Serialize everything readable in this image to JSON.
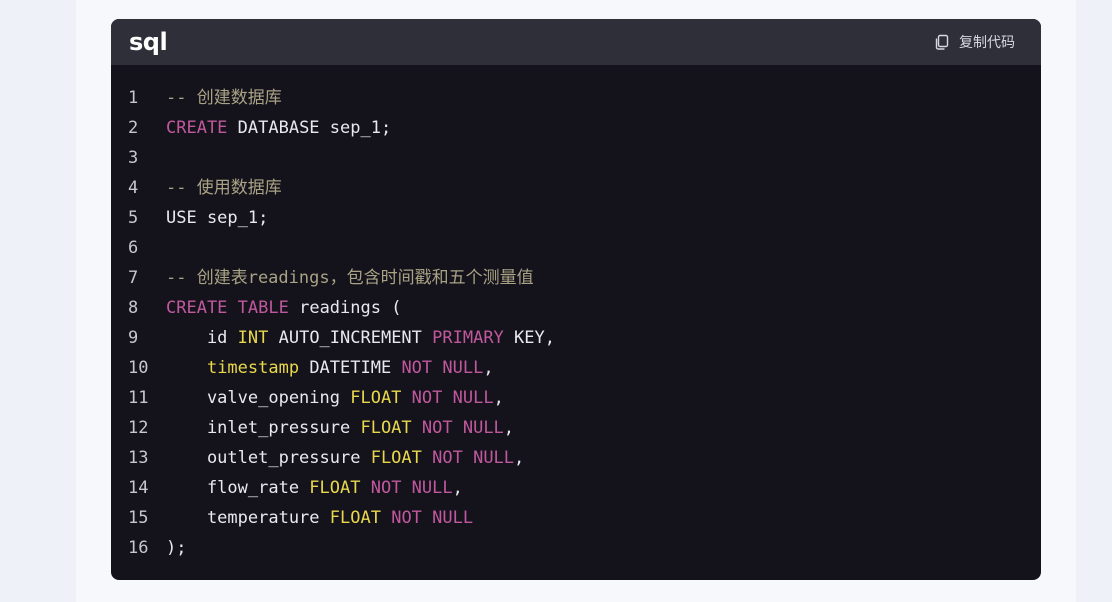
{
  "code_block": {
    "language": "sql",
    "copy_label": "复制代码",
    "icon": "copy-icon",
    "colors": {
      "background": "#14131c",
      "header": "#2f2f39",
      "comment": "#a9a284",
      "keyword": "#c0589d",
      "type": "#e9d84c",
      "plain": "#e8e8ee"
    },
    "lines": [
      {
        "n": "1",
        "tokens": [
          {
            "t": "-- 创建数据库",
            "k": "comment"
          }
        ]
      },
      {
        "n": "2",
        "tokens": [
          {
            "t": "CREATE",
            "k": "keyword"
          },
          {
            "t": " DATABASE sep_1;",
            "k": "plain"
          }
        ]
      },
      {
        "n": "3",
        "tokens": []
      },
      {
        "n": "4",
        "tokens": [
          {
            "t": "-- 使用数据库",
            "k": "comment"
          }
        ]
      },
      {
        "n": "5",
        "tokens": [
          {
            "t": "USE sep_1;",
            "k": "plain"
          }
        ]
      },
      {
        "n": "6",
        "tokens": []
      },
      {
        "n": "7",
        "tokens": [
          {
            "t": "-- 创建表readings，包含时间戳和五个测量值",
            "k": "comment"
          }
        ]
      },
      {
        "n": "8",
        "tokens": [
          {
            "t": "CREATE",
            "k": "keyword"
          },
          {
            "t": " ",
            "k": "plain"
          },
          {
            "t": "TABLE",
            "k": "keyword"
          },
          {
            "t": " readings (",
            "k": "plain"
          }
        ]
      },
      {
        "n": "9",
        "tokens": [
          {
            "t": "    id ",
            "k": "plain"
          },
          {
            "t": "INT",
            "k": "type"
          },
          {
            "t": " AUTO_INCREMENT ",
            "k": "plain"
          },
          {
            "t": "PRIMARY",
            "k": "keyword"
          },
          {
            "t": " KEY,",
            "k": "plain"
          }
        ]
      },
      {
        "n": "10",
        "tokens": [
          {
            "t": "    ",
            "k": "plain"
          },
          {
            "t": "timestamp",
            "k": "type"
          },
          {
            "t": " DATETIME ",
            "k": "plain"
          },
          {
            "t": "NOT NULL",
            "k": "keyword"
          },
          {
            "t": ",",
            "k": "plain"
          }
        ]
      },
      {
        "n": "11",
        "tokens": [
          {
            "t": "    valve_opening ",
            "k": "plain"
          },
          {
            "t": "FLOAT",
            "k": "type"
          },
          {
            "t": " ",
            "k": "plain"
          },
          {
            "t": "NOT NULL",
            "k": "keyword"
          },
          {
            "t": ",",
            "k": "plain"
          }
        ]
      },
      {
        "n": "12",
        "tokens": [
          {
            "t": "    inlet_pressure ",
            "k": "plain"
          },
          {
            "t": "FLOAT",
            "k": "type"
          },
          {
            "t": " ",
            "k": "plain"
          },
          {
            "t": "NOT NULL",
            "k": "keyword"
          },
          {
            "t": ",",
            "k": "plain"
          }
        ]
      },
      {
        "n": "13",
        "tokens": [
          {
            "t": "    outlet_pressure ",
            "k": "plain"
          },
          {
            "t": "FLOAT",
            "k": "type"
          },
          {
            "t": " ",
            "k": "plain"
          },
          {
            "t": "NOT NULL",
            "k": "keyword"
          },
          {
            "t": ",",
            "k": "plain"
          }
        ]
      },
      {
        "n": "14",
        "tokens": [
          {
            "t": "    flow_rate ",
            "k": "plain"
          },
          {
            "t": "FLOAT",
            "k": "type"
          },
          {
            "t": " ",
            "k": "plain"
          },
          {
            "t": "NOT NULL",
            "k": "keyword"
          },
          {
            "t": ",",
            "k": "plain"
          }
        ]
      },
      {
        "n": "15",
        "tokens": [
          {
            "t": "    temperature ",
            "k": "plain"
          },
          {
            "t": "FLOAT",
            "k": "type"
          },
          {
            "t": " ",
            "k": "plain"
          },
          {
            "t": "NOT NULL",
            "k": "keyword"
          }
        ]
      },
      {
        "n": "16",
        "tokens": [
          {
            "t": ");",
            "k": "plain"
          }
        ]
      }
    ]
  }
}
